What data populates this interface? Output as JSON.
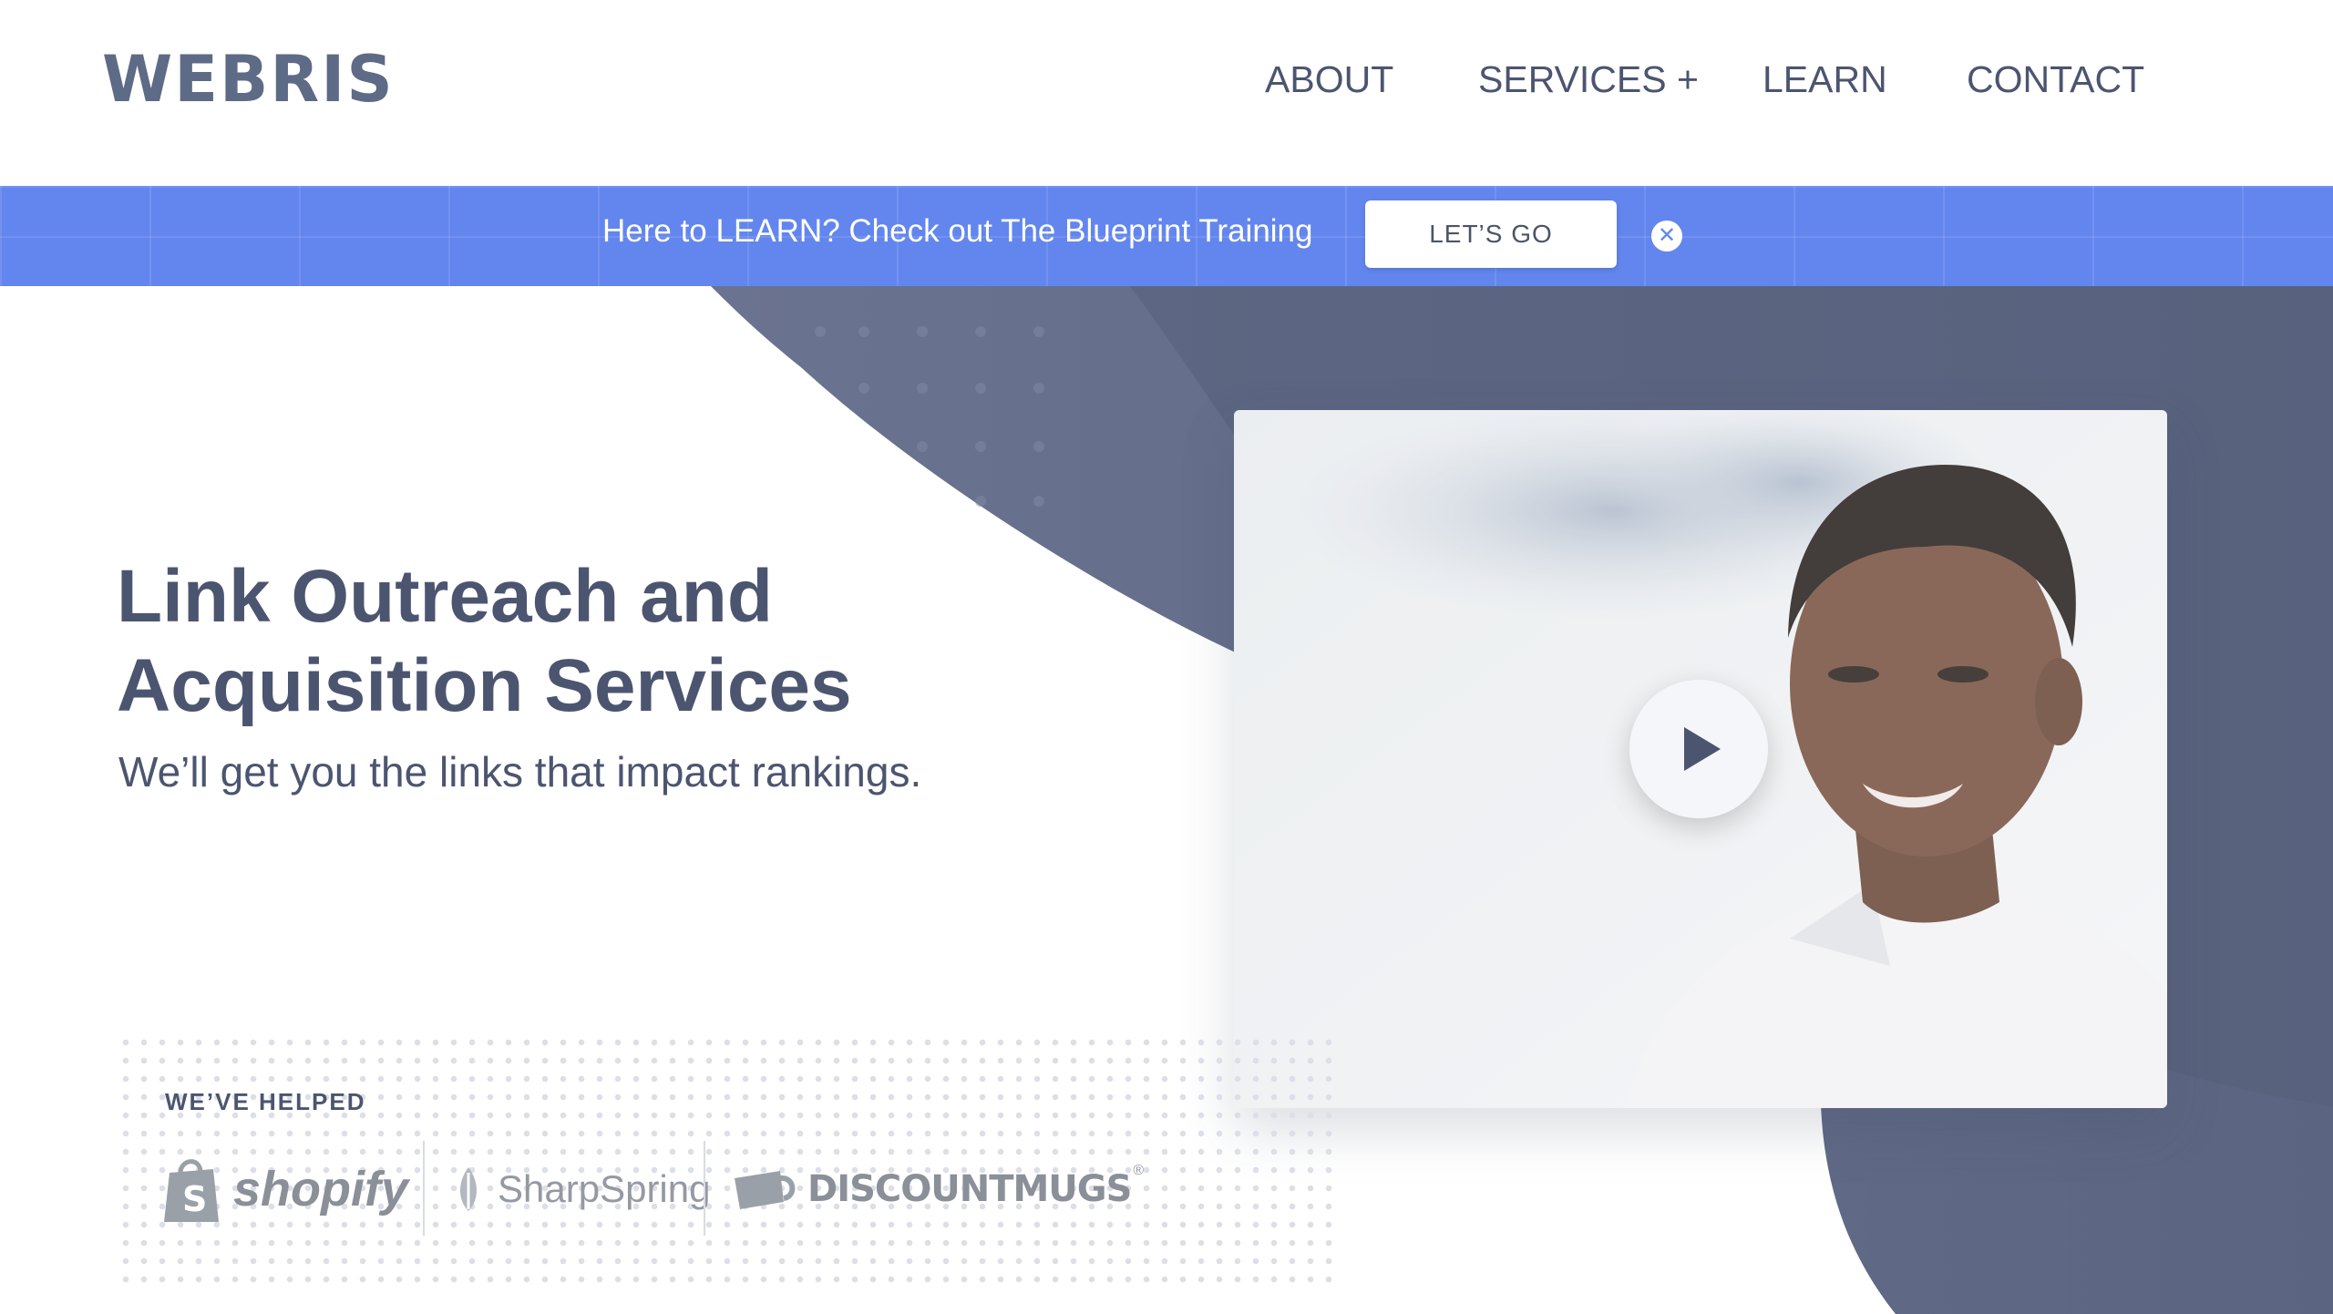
{
  "header": {
    "logo": "WEBRIS",
    "nav": [
      {
        "label": "ABOUT"
      },
      {
        "label": "SERVICES +"
      },
      {
        "label": "LEARN"
      },
      {
        "label": "CONTACT"
      }
    ]
  },
  "banner": {
    "text": "Here to LEARN? Check out The Blueprint Training",
    "button_label": "LET’S GO",
    "close_icon": "close-icon"
  },
  "hero": {
    "title_line1": "Link Outreach and",
    "title_line2": "Acquisition Services",
    "subtitle": "We’ll get you the links that impact rankings."
  },
  "video": {
    "play_icon": "play-icon"
  },
  "helped": {
    "label": "WE’VE HELPED",
    "brands": [
      {
        "name": "shopify",
        "icon": "shopify-bag-icon"
      },
      {
        "name": "SharpSpring",
        "icon": "sharpspring-leaf-icon"
      },
      {
        "name": "DISCOUNTMUGS",
        "icon": "mug-icon",
        "mark": "®"
      }
    ]
  },
  "colors": {
    "text": "#4c5570",
    "logo": "#5e6b86",
    "banner": "#6386ee",
    "hero_shape": "#5b6581",
    "button_bg": "#ffffff"
  }
}
